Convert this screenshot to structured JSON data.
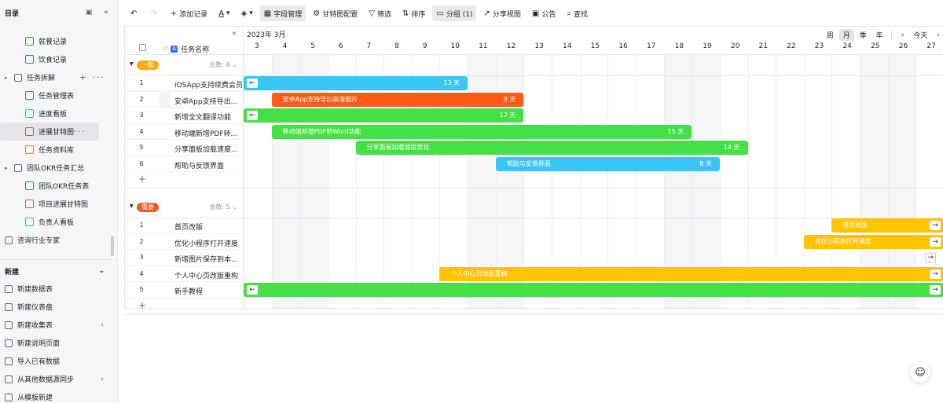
{
  "sidebar": {
    "title": "目录",
    "items": [
      {
        "label": "就餐记录",
        "color": "#2ea121",
        "level": 1
      },
      {
        "label": "饮食记录",
        "color": "#3370ff",
        "level": 1
      },
      {
        "label": "任务拆解",
        "level": 0,
        "group": true
      },
      {
        "label": "任务管理表",
        "color": "#2ea121",
        "level": 1
      },
      {
        "label": "进度看板",
        "color": "#14c0ff",
        "level": 1
      },
      {
        "label": "进展甘特图",
        "color": "#f54a45",
        "level": 1,
        "active": true
      },
      {
        "label": "任务资料库",
        "color": "#ff7d00",
        "level": 1
      },
      {
        "label": "团队OKR任务汇总",
        "level": 0,
        "group": true
      },
      {
        "label": "团队OKR任务表",
        "color": "#2ea121",
        "level": 1
      },
      {
        "label": "项目进展甘特图",
        "color": "#f54a45",
        "level": 1
      },
      {
        "label": "负责人看板",
        "color": "#14c0ff",
        "level": 1
      },
      {
        "label": "咨询行业专家",
        "level": 0,
        "doc": true
      }
    ],
    "new_section": {
      "title": "新建",
      "items": [
        {
          "label": "新建数据表"
        },
        {
          "label": "新建仪表盘"
        },
        {
          "label": "新建收集表",
          "arrow": true
        },
        {
          "label": "新建说明页面"
        },
        {
          "label": "导入已有数据"
        },
        {
          "label": "从其他数据源同步",
          "arrow": true
        },
        {
          "label": "从模板新建"
        }
      ]
    }
  },
  "toolbar": {
    "add_record": "添加记录",
    "field_manage": "字段管理",
    "gantt_config": "甘特图配置",
    "filter": "筛选",
    "sort": "排序",
    "group": "分组 (1)",
    "share_view": "分享视图",
    "notice": "公告",
    "search": "查找"
  },
  "gantt": {
    "task_name_header": "任务名称",
    "month_label": "2023年 3月",
    "scale": {
      "week": "周",
      "month": "月",
      "quarter": "季",
      "year": "年",
      "today": "今天",
      "active": "月"
    },
    "days": [
      "3",
      "4",
      "5",
      "6",
      "7",
      "8",
      "9",
      "10",
      "11",
      "12",
      "13",
      "14",
      "15",
      "16",
      "17",
      "18",
      "19",
      "20",
      "21",
      "22",
      "23",
      "24",
      "25",
      "26",
      "27"
    ],
    "weekend_days": [
      "4",
      "5",
      "11",
      "12",
      "18",
      "19",
      "25",
      "26"
    ],
    "groups": [
      {
        "tag": "一般",
        "tag_color": "#ffaa00",
        "total": "总数: 6",
        "tasks": [
          {
            "num": "1",
            "name": "iOSApp支持续费会员",
            "bar_label": "",
            "duration": "13 天",
            "start": 0,
            "days": 8,
            "color": "#38c6f5",
            "left_arrow": true
          },
          {
            "num": "2",
            "name": "安卓App支持导出...",
            "bar_label": "安卓App支持导出高清图片",
            "duration": "9 天",
            "start": 1,
            "days": 9,
            "color": "#fe5c17"
          },
          {
            "num": "3",
            "name": "新增全文翻译功能",
            "bar_label": "",
            "duration": "12 天",
            "start": 0,
            "days": 10,
            "color": "#45e045",
            "left_arrow": true
          },
          {
            "num": "4",
            "name": "移动端新增PDF转...",
            "bar_label": "移动端新增PDF转Word功能",
            "duration": "15 天",
            "start": 1,
            "days": 15,
            "color": "#45e045"
          },
          {
            "num": "5",
            "name": "分享面板加载速度...",
            "bar_label": "分享面板加载速度优化",
            "duration": "14 天",
            "start": 4,
            "days": 14,
            "color": "#45e045"
          },
          {
            "num": "6",
            "name": "帮助与反馈界面",
            "bar_label": "帮助与反馈界面",
            "duration": "8 天",
            "start": 9,
            "days": 8,
            "color": "#38c6f5"
          }
        ]
      },
      {
        "tag": "重要",
        "tag_color": "#f05a24",
        "total": "总数: 5",
        "tasks": [
          {
            "num": "1",
            "name": "首页改版",
            "bar_label": "首页改版",
            "duration": "",
            "start": 21,
            "days": 4,
            "color": "#ffc300",
            "right_arrow": true
          },
          {
            "num": "2",
            "name": "优化小程序打开速度",
            "bar_label": "优化小程序打开速度",
            "duration": "",
            "start": 20,
            "days": 5,
            "color": "#ffc300",
            "right_arrow": true
          },
          {
            "num": "3",
            "name": "新增图片保存到本...",
            "bar_label": "",
            "duration": "",
            "start": -1,
            "days": 0,
            "color": "",
            "arrow_only": true
          },
          {
            "num": "4",
            "name": "个人中心页改版重构",
            "bar_label": "个人中心页改版重构",
            "duration": "",
            "start": 7,
            "days": 18,
            "color": "#ffc300",
            "right_arrow": true
          },
          {
            "num": "5",
            "name": "新手教程",
            "bar_label": "",
            "duration": "",
            "start": 0,
            "days": 25,
            "color": "#45e045",
            "left_arrow": true,
            "right_arrow": true
          }
        ]
      }
    ]
  }
}
